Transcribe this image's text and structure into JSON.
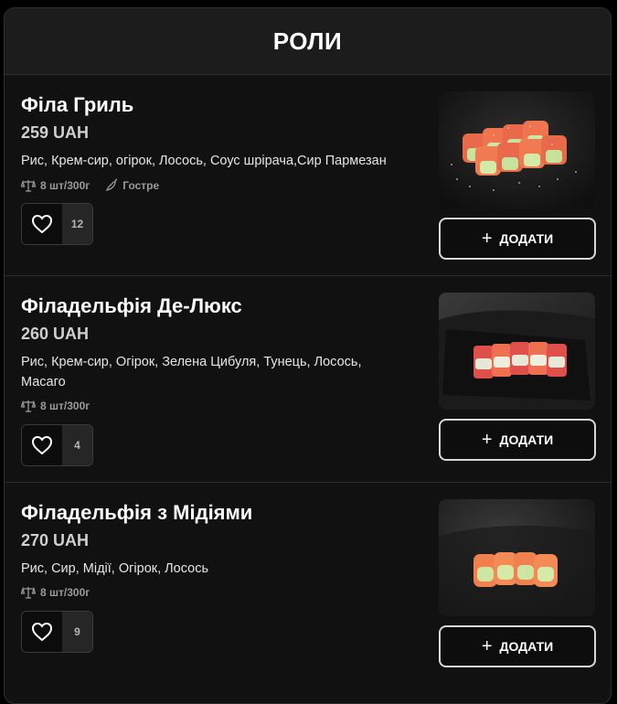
{
  "category": {
    "title": "РОЛИ"
  },
  "items": [
    {
      "title": "Філа Гриль",
      "price": "259 UAH",
      "ingredients": "Рис, Крем-сир, огірок, Лосось, Соус шрірача,Сир Пармезан",
      "portion": "8 шт/300г",
      "tag": "Гостре",
      "likes": "12",
      "add_label": "ДОДАТИ",
      "image": "grilled-salmon-rolls"
    },
    {
      "title": "Філадельфія Де-Люкс",
      "price": "260 UAH",
      "ingredients": "Рис, Крем-сир, Огірок, Зелена Цибуля, Тунець, Лосось, Масаго",
      "portion": "8 шт/300г",
      "likes": "4",
      "add_label": "ДОДАТИ",
      "image": "philadelphia-deluxe-rolls"
    },
    {
      "title": "Філадельфія з Мідіями",
      "price": "270 UAH",
      "ingredients": "Рис, Сир, Мідії, Огірок, Лосось",
      "portion": "8 шт/300г",
      "likes": "9",
      "add_label": "ДОДАТИ",
      "image": "philadelphia-mussels-rolls"
    }
  ],
  "icons": {
    "heart": "heart-icon",
    "weight": "scales-icon",
    "spicy": "chili-icon",
    "add": "plus-icon"
  }
}
